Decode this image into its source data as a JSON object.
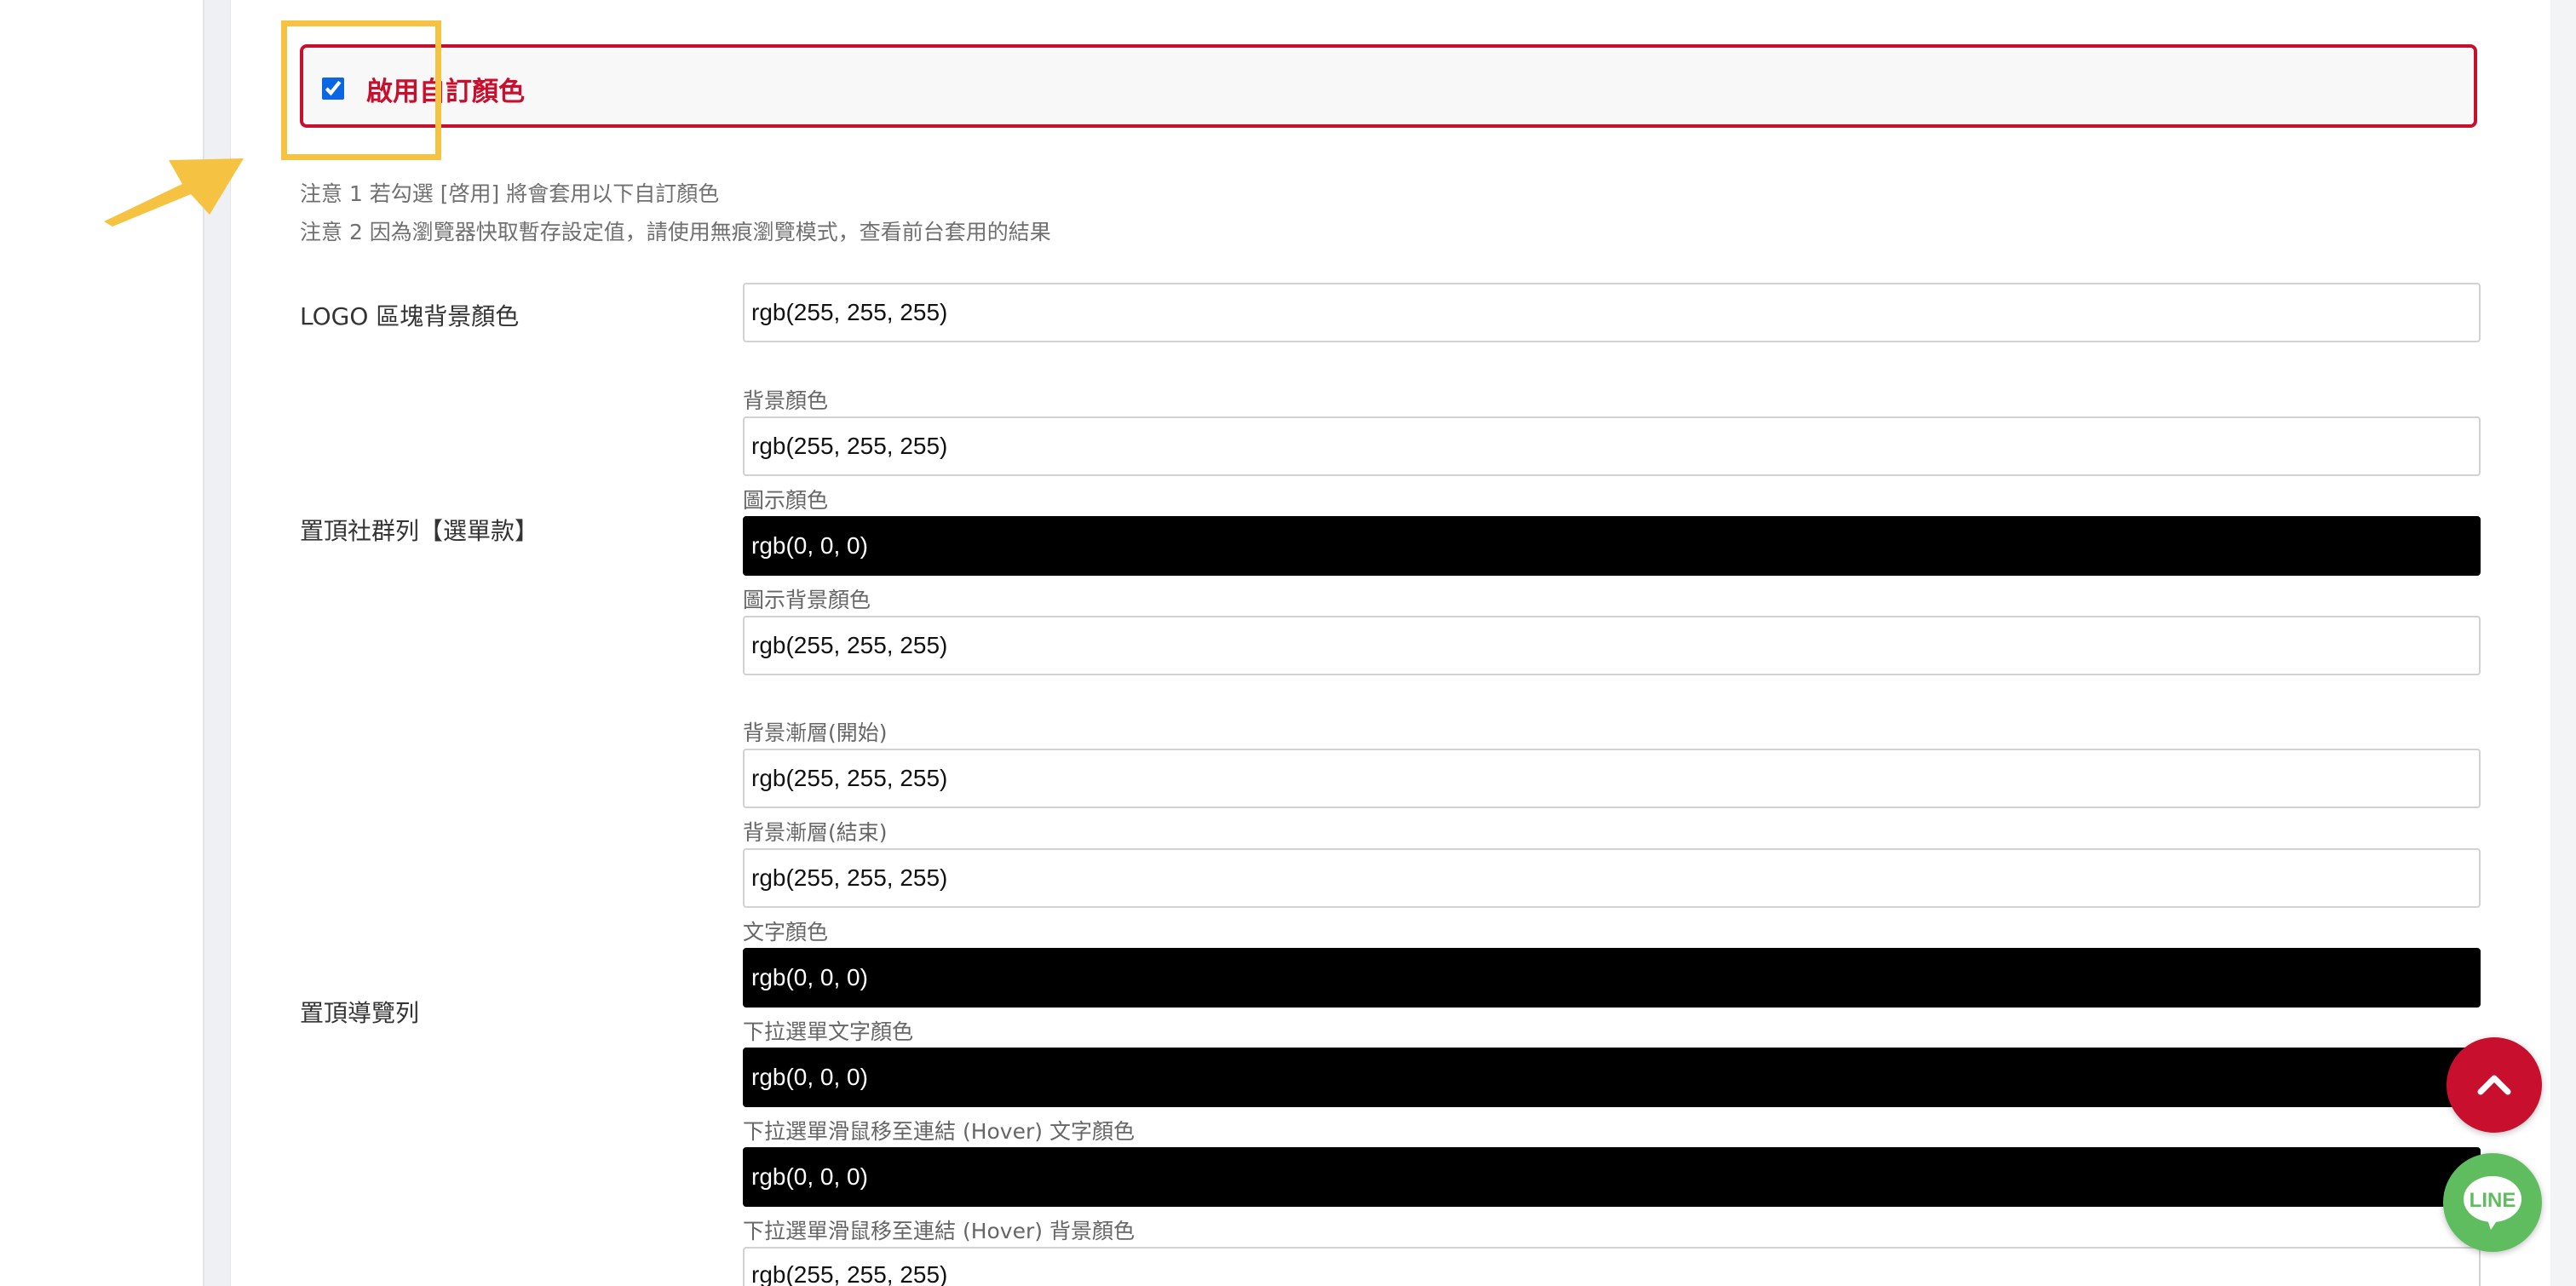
{
  "enable": {
    "label": "啟用自訂顏色",
    "checked": true
  },
  "notes": [
    "注意 1 若勾選 [啓用] 將會套用以下自訂顏色",
    "注意 2 因為瀏覽器快取暫存設定值，請使用無痕瀏覽模式，查看前台套用的結果"
  ],
  "logo_section": {
    "label": "LOGO 區塊背景顏色",
    "value": "rgb(255, 255, 255)"
  },
  "social_bar": {
    "label": "置頂社群列【選單款】",
    "fields": [
      {
        "caption": "背景顏色",
        "value": "rgb(255, 255, 255)"
      },
      {
        "caption": "圖示顏色",
        "value": "rgb(0, 0, 0)"
      },
      {
        "caption": "圖示背景顏色",
        "value": "rgb(255, 255, 255)"
      }
    ]
  },
  "nav_bar": {
    "label": "置頂導覽列",
    "fields": [
      {
        "caption": "背景漸層(開始)",
        "value": "rgb(255, 255, 255)"
      },
      {
        "caption": "背景漸層(結束)",
        "value": "rgb(255, 255, 255)"
      },
      {
        "caption": "文字顏色",
        "value": "rgb(0, 0, 0)"
      },
      {
        "caption": "下拉選單文字顏色",
        "value": "rgb(0, 0, 0)"
      },
      {
        "caption": "下拉選單滑鼠移至連結 (Hover) 文字顏色",
        "value": "rgb(0, 0, 0)"
      },
      {
        "caption": "下拉選單滑鼠移至連結 (Hover) 背景顏色",
        "value": "rgb(255, 255, 255)"
      }
    ]
  },
  "floating": {
    "line_label": "LINE"
  },
  "colors": {
    "accent": "#c8102e",
    "highlight": "#f5c242",
    "line_green": "#5fbd5f"
  }
}
